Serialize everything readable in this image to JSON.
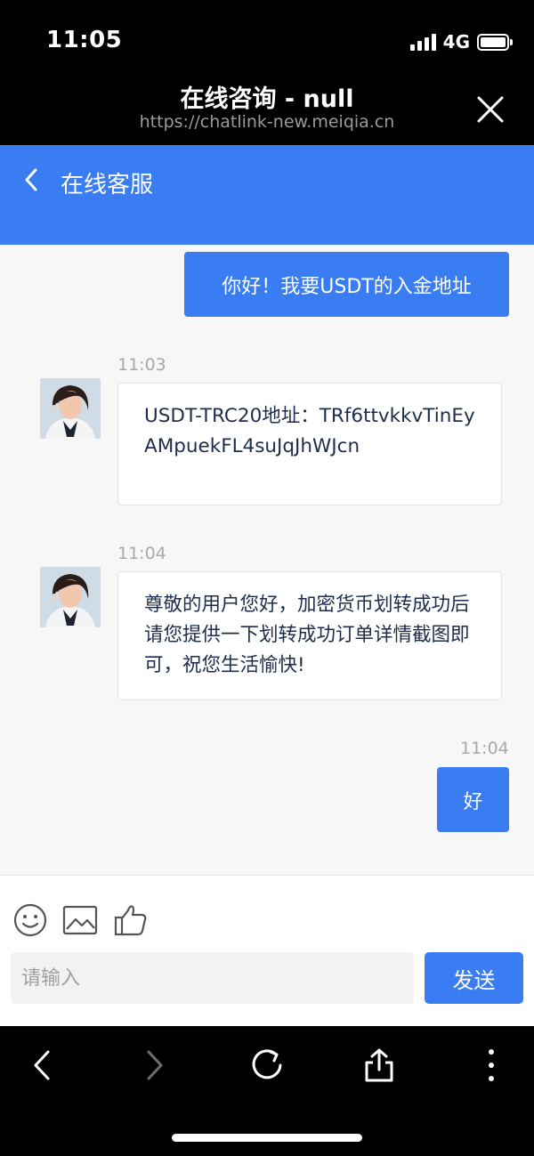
{
  "status_bar": {
    "time": "11:05",
    "network": "4G",
    "signal_bars": 4,
    "battery_level": 1.0
  },
  "browser": {
    "title": "在线咨询 - null",
    "url": "https://chatlink-new.meiqia.cn",
    "close_icon": "close-icon"
  },
  "chat_header": {
    "title": "在线客服",
    "back_icon": "chevron-left-icon"
  },
  "messages": [
    {
      "side": "right",
      "text": "你好！我要USDT的入金地址"
    },
    {
      "side": "left",
      "time": "11:03",
      "text": "USDT-TRC20地址：TRf6ttvkkvTinEyAMpuekFL4suJqJhWJcn"
    },
    {
      "side": "left",
      "time": "11:04",
      "text": "尊敬的用户您好，加密货币划转成功后请您提供一下划转成功订单详情截图即可，祝您生活愉快!"
    },
    {
      "side": "right",
      "time": "11:04",
      "text": "好"
    }
  ],
  "input_panel": {
    "tools": [
      "emoji-icon",
      "image-icon",
      "thumbs-up-icon"
    ],
    "placeholder": "请输入",
    "send_label": "发送"
  },
  "toolbar": {
    "icons": [
      "back-icon",
      "forward-icon",
      "reload-icon",
      "share-icon",
      "more-icon"
    ]
  },
  "colors": {
    "accent": "#3a7cf2",
    "chat_bg": "#f7f7f7",
    "bubble_text": "#1f2c4d",
    "timestamp": "#a8a8a8"
  }
}
